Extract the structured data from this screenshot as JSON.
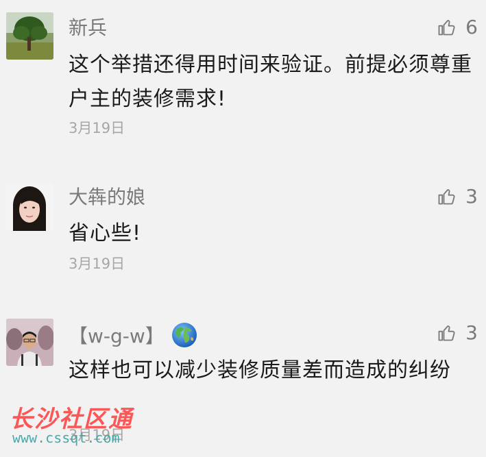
{
  "comments": [
    {
      "name": "新兵",
      "content": "这个举措还得用时间来验证。前提必须尊重户主的装修需求!",
      "date": "3月19日",
      "likes": "6",
      "avatar_icon": "tree-landscape-avatar"
    },
    {
      "name": "大犇的娘",
      "content": "省心些!",
      "date": "3月19日",
      "likes": "3",
      "avatar_icon": "woman-portrait-avatar"
    },
    {
      "name": "【w-g-w】",
      "content": "这样也可以减少装修质量差而造成的纠纷",
      "date": "3月19日",
      "likes": "3",
      "avatar_icon": "man-portrait-avatar",
      "name_emoji": "globe-icon"
    }
  ],
  "watermark": {
    "title": "长沙社区通",
    "url": "www.cssqt.com"
  },
  "colors": {
    "background": "#f2f2f2",
    "name": "#7a7a7a",
    "content": "#1a1a1a",
    "date": "#a6a6a6",
    "watermark_red": "#ff3b3b",
    "watermark_teal": "#37a3a3"
  }
}
